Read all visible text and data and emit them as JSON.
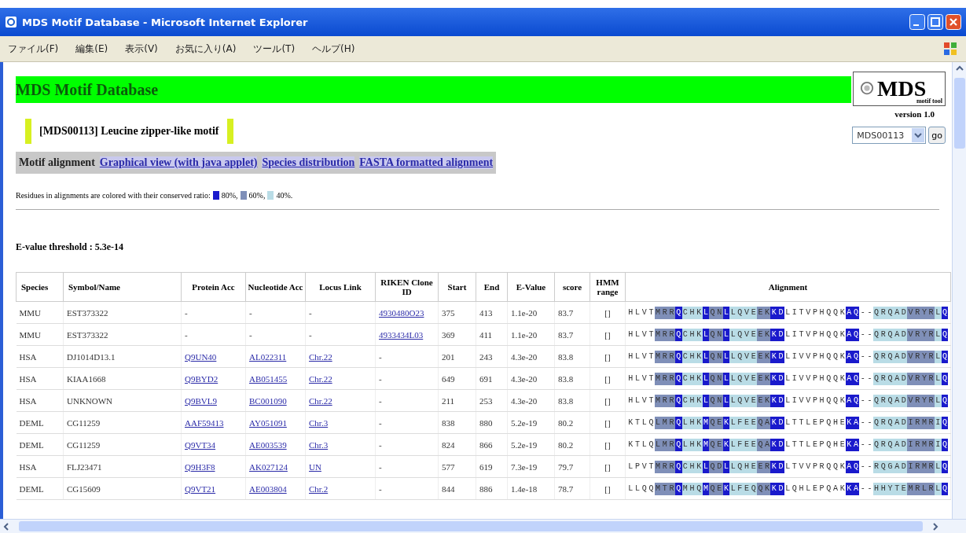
{
  "window": {
    "title": "MDS Motif Database - Microsoft Internet Explorer"
  },
  "menu": [
    "ファイル(F)",
    "編集(E)",
    "表示(V)",
    "お気に入り(A)",
    "ツール(T)",
    "ヘルプ(H)"
  ],
  "banner": {
    "title": "MDS Motif Database"
  },
  "logo": {
    "text": "MDS",
    "subtitle": "motif tool",
    "version": "version 1.0"
  },
  "motif_title": "[MDS00113] Leucine zipper-like motif",
  "motif_select": {
    "value": "MDS00113",
    "button": "go"
  },
  "nav": [
    {
      "label": "Motif alignment",
      "kind": "current"
    },
    {
      "label": "Graphical view (with java applet)",
      "kind": "link"
    },
    {
      "label": "Species distribution",
      "kind": "link"
    },
    {
      "label": "FASTA formatted alignment",
      "kind": "link"
    }
  ],
  "legend": {
    "text": "Residues in alignments are colored with their conserved ratio:",
    "items": [
      {
        "label": "80%,",
        "color": "#1a1acc"
      },
      {
        "label": "60%,",
        "color": "#7f8fb8"
      },
      {
        "label": "40%.",
        "color": "#b9dce6"
      }
    ]
  },
  "threshold": "E-value threshold : 5.3e-14",
  "table": {
    "columns": [
      "Species",
      "Symbol/Name",
      "Protein Acc",
      "Nucleotide Acc",
      "Locus Link",
      "RIKEN Clone ID",
      "Start",
      "End",
      "E-Value",
      "score",
      "HMM range",
      "Alignment"
    ],
    "rows": [
      {
        "species": "MMU",
        "name": "EST373322",
        "protein": "-",
        "nucleotide": "-",
        "locus": "-",
        "clone": "4930480O23",
        "start": "375",
        "end": "413",
        "evalue": "1.1e-20",
        "score": "83.7",
        "hmm": "[]",
        "alignment": [
          {
            "text": "HLVT",
            "kind": "plain"
          },
          {
            "text": "MRR",
            "kind": "mid"
          },
          {
            "text": "Q",
            "kind": "high"
          },
          {
            "text": "CHK",
            "kind": "low"
          },
          {
            "text": "L",
            "kind": "high"
          },
          {
            "text": "QN",
            "kind": "mid"
          },
          {
            "text": "L",
            "kind": "high"
          },
          {
            "text": "LQVE",
            "kind": "low"
          },
          {
            "text": "EK",
            "kind": "mid"
          },
          {
            "text": "KD",
            "kind": "high"
          },
          {
            "text": "LITVPHQQK",
            "kind": "plain"
          },
          {
            "text": "AQ",
            "kind": "high"
          },
          {
            "text": "--",
            "kind": "plain"
          },
          {
            "text": "QRQAD",
            "kind": "low"
          },
          {
            "text": "VRYR",
            "kind": "mid"
          },
          {
            "text": "L",
            "kind": "low"
          },
          {
            "text": "Q",
            "kind": "high"
          }
        ]
      },
      {
        "species": "MMU",
        "name": "EST373322",
        "protein": "-",
        "nucleotide": "-",
        "locus": "-",
        "clone": "4933434L03",
        "start": "369",
        "end": "411",
        "evalue": "1.1e-20",
        "score": "83.7",
        "hmm": "[]",
        "alignment": [
          {
            "text": "HLVT",
            "kind": "plain"
          },
          {
            "text": "MRR",
            "kind": "mid"
          },
          {
            "text": "Q",
            "kind": "high"
          },
          {
            "text": "CHK",
            "kind": "low"
          },
          {
            "text": "L",
            "kind": "high"
          },
          {
            "text": "QN",
            "kind": "mid"
          },
          {
            "text": "L",
            "kind": "high"
          },
          {
            "text": "LQVE",
            "kind": "low"
          },
          {
            "text": "EK",
            "kind": "mid"
          },
          {
            "text": "KD",
            "kind": "high"
          },
          {
            "text": "LITVPHQQK",
            "kind": "plain"
          },
          {
            "text": "AQ",
            "kind": "high"
          },
          {
            "text": "--",
            "kind": "plain"
          },
          {
            "text": "QRQAD",
            "kind": "low"
          },
          {
            "text": "VRYR",
            "kind": "mid"
          },
          {
            "text": "L",
            "kind": "low"
          },
          {
            "text": "Q",
            "kind": "high"
          }
        ]
      },
      {
        "species": "HSA",
        "name": "DJ1014D13.1",
        "protein": "Q9UN40",
        "nucleotide": "AL022311",
        "locus": "Chr.22",
        "clone": "-",
        "start": "201",
        "end": "243",
        "evalue": "4.3e-20",
        "score": "83.8",
        "hmm": "[]",
        "alignment": [
          {
            "text": "HLVT",
            "kind": "plain"
          },
          {
            "text": "MRR",
            "kind": "mid"
          },
          {
            "text": "Q",
            "kind": "high"
          },
          {
            "text": "CHK",
            "kind": "low"
          },
          {
            "text": "L",
            "kind": "high"
          },
          {
            "text": "QN",
            "kind": "mid"
          },
          {
            "text": "L",
            "kind": "high"
          },
          {
            "text": "LQVE",
            "kind": "low"
          },
          {
            "text": "EK",
            "kind": "mid"
          },
          {
            "text": "KD",
            "kind": "high"
          },
          {
            "text": "LIVVPHQQK",
            "kind": "plain"
          },
          {
            "text": "AQ",
            "kind": "high"
          },
          {
            "text": "--",
            "kind": "plain"
          },
          {
            "text": "QRQAD",
            "kind": "low"
          },
          {
            "text": "VRYR",
            "kind": "mid"
          },
          {
            "text": "L",
            "kind": "low"
          },
          {
            "text": "Q",
            "kind": "high"
          }
        ]
      },
      {
        "species": "HSA",
        "name": "KIAA1668",
        "protein": "Q9BYD2",
        "nucleotide": "AB051455",
        "locus": "Chr.22",
        "clone": "-",
        "start": "649",
        "end": "691",
        "evalue": "4.3e-20",
        "score": "83.8",
        "hmm": "[]",
        "alignment": [
          {
            "text": "HLVT",
            "kind": "plain"
          },
          {
            "text": "MRR",
            "kind": "mid"
          },
          {
            "text": "Q",
            "kind": "high"
          },
          {
            "text": "CHK",
            "kind": "low"
          },
          {
            "text": "L",
            "kind": "high"
          },
          {
            "text": "QN",
            "kind": "mid"
          },
          {
            "text": "L",
            "kind": "high"
          },
          {
            "text": "LQVE",
            "kind": "low"
          },
          {
            "text": "EK",
            "kind": "mid"
          },
          {
            "text": "KD",
            "kind": "high"
          },
          {
            "text": "LIVVPHQQK",
            "kind": "plain"
          },
          {
            "text": "AQ",
            "kind": "high"
          },
          {
            "text": "--",
            "kind": "plain"
          },
          {
            "text": "QRQAD",
            "kind": "low"
          },
          {
            "text": "VRYR",
            "kind": "mid"
          },
          {
            "text": "L",
            "kind": "low"
          },
          {
            "text": "Q",
            "kind": "high"
          }
        ]
      },
      {
        "species": "HSA",
        "name": "UNKNOWN",
        "protein": "Q9BVL9",
        "nucleotide": "BC001090",
        "locus": "Chr.22",
        "clone": "-",
        "start": "211",
        "end": "253",
        "evalue": "4.3e-20",
        "score": "83.8",
        "hmm": "[]",
        "alignment": [
          {
            "text": "HLVT",
            "kind": "plain"
          },
          {
            "text": "MRR",
            "kind": "mid"
          },
          {
            "text": "Q",
            "kind": "high"
          },
          {
            "text": "CHK",
            "kind": "low"
          },
          {
            "text": "L",
            "kind": "high"
          },
          {
            "text": "QN",
            "kind": "mid"
          },
          {
            "text": "L",
            "kind": "high"
          },
          {
            "text": "LQVE",
            "kind": "low"
          },
          {
            "text": "EK",
            "kind": "mid"
          },
          {
            "text": "KD",
            "kind": "high"
          },
          {
            "text": "LIVVPHQQK",
            "kind": "plain"
          },
          {
            "text": "AQ",
            "kind": "high"
          },
          {
            "text": "--",
            "kind": "plain"
          },
          {
            "text": "QRQAD",
            "kind": "low"
          },
          {
            "text": "VRYR",
            "kind": "mid"
          },
          {
            "text": "L",
            "kind": "low"
          },
          {
            "text": "Q",
            "kind": "high"
          }
        ]
      },
      {
        "species": "DEML",
        "name": "CG11259",
        "protein": "AAF59413",
        "nucleotide": "AY051091",
        "locus": "Chr.3",
        "clone": "-",
        "start": "838",
        "end": "880",
        "evalue": "5.2e-19",
        "score": "80.2",
        "hmm": "[]",
        "alignment": [
          {
            "text": "KTLQ",
            "kind": "plain"
          },
          {
            "text": "LMR",
            "kind": "mid"
          },
          {
            "text": "Q",
            "kind": "high"
          },
          {
            "text": "LHK",
            "kind": "low"
          },
          {
            "text": "M",
            "kind": "high"
          },
          {
            "text": "QE",
            "kind": "mid"
          },
          {
            "text": "K",
            "kind": "high"
          },
          {
            "text": "LFEE",
            "kind": "low"
          },
          {
            "text": "QA",
            "kind": "mid"
          },
          {
            "text": "KD",
            "kind": "high"
          },
          {
            "text": "LTTLEPQHE",
            "kind": "plain"
          },
          {
            "text": "KA",
            "kind": "high"
          },
          {
            "text": "--",
            "kind": "plain"
          },
          {
            "text": "QRQAD",
            "kind": "low"
          },
          {
            "text": "IRMR",
            "kind": "mid"
          },
          {
            "text": "I",
            "kind": "low"
          },
          {
            "text": "Q",
            "kind": "high"
          }
        ]
      },
      {
        "species": "DEML",
        "name": "CG11259",
        "protein": "Q9VT34",
        "nucleotide": "AE003539",
        "locus": "Chr.3",
        "clone": "-",
        "start": "824",
        "end": "866",
        "evalue": "5.2e-19",
        "score": "80.2",
        "hmm": "[]",
        "alignment": [
          {
            "text": "KTLQ",
            "kind": "plain"
          },
          {
            "text": "LMR",
            "kind": "mid"
          },
          {
            "text": "Q",
            "kind": "high"
          },
          {
            "text": "LHK",
            "kind": "low"
          },
          {
            "text": "M",
            "kind": "high"
          },
          {
            "text": "QE",
            "kind": "mid"
          },
          {
            "text": "K",
            "kind": "high"
          },
          {
            "text": "LFEE",
            "kind": "low"
          },
          {
            "text": "QA",
            "kind": "mid"
          },
          {
            "text": "KD",
            "kind": "high"
          },
          {
            "text": "LTTLEPQHE",
            "kind": "plain"
          },
          {
            "text": "KA",
            "kind": "high"
          },
          {
            "text": "--",
            "kind": "plain"
          },
          {
            "text": "QRQAD",
            "kind": "low"
          },
          {
            "text": "IRMR",
            "kind": "mid"
          },
          {
            "text": "I",
            "kind": "low"
          },
          {
            "text": "Q",
            "kind": "high"
          }
        ]
      },
      {
        "species": "HSA",
        "name": "FLJ23471",
        "protein": "Q9H3F8",
        "nucleotide": "AK027124",
        "locus": "UN",
        "clone": "-",
        "start": "577",
        "end": "619",
        "evalue": "7.3e-19",
        "score": "79.7",
        "hmm": "[]",
        "alignment": [
          {
            "text": "LPVT",
            "kind": "plain"
          },
          {
            "text": "MRR",
            "kind": "mid"
          },
          {
            "text": "Q",
            "kind": "high"
          },
          {
            "text": "CHK",
            "kind": "low"
          },
          {
            "text": "L",
            "kind": "high"
          },
          {
            "text": "QD",
            "kind": "mid"
          },
          {
            "text": "L",
            "kind": "high"
          },
          {
            "text": "LQHE",
            "kind": "low"
          },
          {
            "text": "ER",
            "kind": "mid"
          },
          {
            "text": "KD",
            "kind": "high"
          },
          {
            "text": "LTVVPRQQK",
            "kind": "plain"
          },
          {
            "text": "AQ",
            "kind": "high"
          },
          {
            "text": "--",
            "kind": "plain"
          },
          {
            "text": "RQGAD",
            "kind": "low"
          },
          {
            "text": "IRMR",
            "kind": "mid"
          },
          {
            "text": "L",
            "kind": "low"
          },
          {
            "text": "Q",
            "kind": "high"
          }
        ]
      },
      {
        "species": "DEML",
        "name": "CG15609",
        "protein": "Q9VT21",
        "nucleotide": "AE003804",
        "locus": "Chr.2",
        "clone": "-",
        "start": "844",
        "end": "886",
        "evalue": "1.4e-18",
        "score": "78.7",
        "hmm": "[]",
        "alignment": [
          {
            "text": "LLQQ",
            "kind": "plain"
          },
          {
            "text": "MTR",
            "kind": "mid"
          },
          {
            "text": "Q",
            "kind": "high"
          },
          {
            "text": "MHQ",
            "kind": "low"
          },
          {
            "text": "M",
            "kind": "high"
          },
          {
            "text": "QE",
            "kind": "mid"
          },
          {
            "text": "K",
            "kind": "high"
          },
          {
            "text": "LFEQ",
            "kind": "low"
          },
          {
            "text": "QK",
            "kind": "mid"
          },
          {
            "text": "KD",
            "kind": "high"
          },
          {
            "text": "LQHLEPQAK",
            "kind": "plain"
          },
          {
            "text": "KA",
            "kind": "high"
          },
          {
            "text": "--",
            "kind": "plain"
          },
          {
            "text": "HHYTE",
            "kind": "low"
          },
          {
            "text": "MRLR",
            "kind": "mid"
          },
          {
            "text": "L",
            "kind": "low"
          },
          {
            "text": "Q",
            "kind": "high"
          }
        ]
      }
    ]
  }
}
